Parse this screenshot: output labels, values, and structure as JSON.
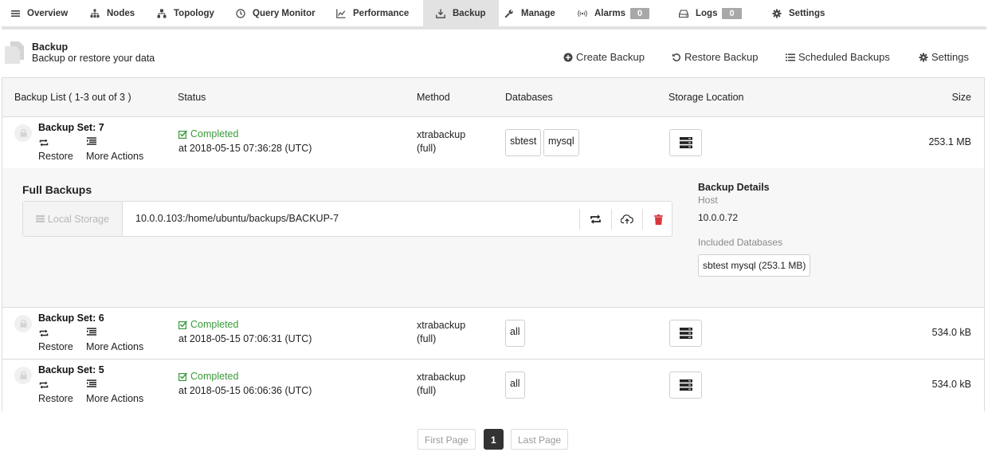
{
  "nav": {
    "tabs": [
      {
        "label": "Overview",
        "icon": "menu-icon"
      },
      {
        "label": "Nodes",
        "icon": "nodes-icon"
      },
      {
        "label": "Topology",
        "icon": "topology-icon"
      },
      {
        "label": "Query Monitor",
        "icon": "clock-icon"
      },
      {
        "label": "Performance",
        "icon": "chart-icon"
      },
      {
        "label": "Backup",
        "icon": "download-tray-icon",
        "active": true
      },
      {
        "label": "Manage",
        "icon": "wrench-icon"
      },
      {
        "label": "Alarms",
        "icon": "broadcast-icon",
        "count": "0"
      },
      {
        "label": "Logs",
        "icon": "hdd-icon",
        "count": "0"
      },
      {
        "label": "Settings",
        "icon": "gear-icon"
      }
    ]
  },
  "header": {
    "title": "Backup",
    "subtitle": "Backup or restore your data",
    "actions": {
      "create": "Create Backup",
      "restore": "Restore Backup",
      "scheduled": "Scheduled Backups",
      "settings": "Settings"
    }
  },
  "table": {
    "columns": {
      "list": "Backup List ( 1-3 out of 3 )",
      "status": "Status",
      "method": "Method",
      "databases": "Databases",
      "storage": "Storage Location",
      "size": "Size"
    },
    "restore_label": "Restore",
    "more_label": "More Actions",
    "rows": [
      {
        "title": "Backup Set: 7",
        "status": "Completed",
        "at": "at 2018-05-15 07:36:28 (UTC)",
        "method": "xtrabackup",
        "method_type": "(full)",
        "databases": [
          "sbtest",
          "mysql"
        ],
        "size": "253.1 MB"
      },
      {
        "title": "Backup Set: 6",
        "status": "Completed",
        "at": "at 2018-05-15 07:06:31 (UTC)",
        "method": "xtrabackup",
        "method_type": "(full)",
        "databases": [
          "all"
        ],
        "size": "534.0 kB"
      },
      {
        "title": "Backup Set: 5",
        "status": "Completed",
        "at": "at 2018-05-15 06:06:36 (UTC)",
        "method": "xtrabackup",
        "method_type": "(full)",
        "databases": [
          "all"
        ],
        "size": "534.0 kB"
      }
    ]
  },
  "details": {
    "full_backups_title": "Full Backups",
    "local_storage": "Local Storage",
    "path": "10.0.0.103:/home/ubuntu/backups/BACKUP-7",
    "backup_details_title": "Backup Details",
    "host_label": "Host",
    "host_value": "10.0.0.72",
    "included_label": "Included Databases",
    "included_value": "sbtest mysql (253.1 MB)"
  },
  "pagination": {
    "first": "First Page",
    "current": "1",
    "last": "Last Page"
  },
  "colors": {
    "completed_green": "#3a9a3a",
    "delete_red": "#d9363e",
    "count_pill": "#a8a8a8",
    "active_tab": "#e2e2e2"
  }
}
